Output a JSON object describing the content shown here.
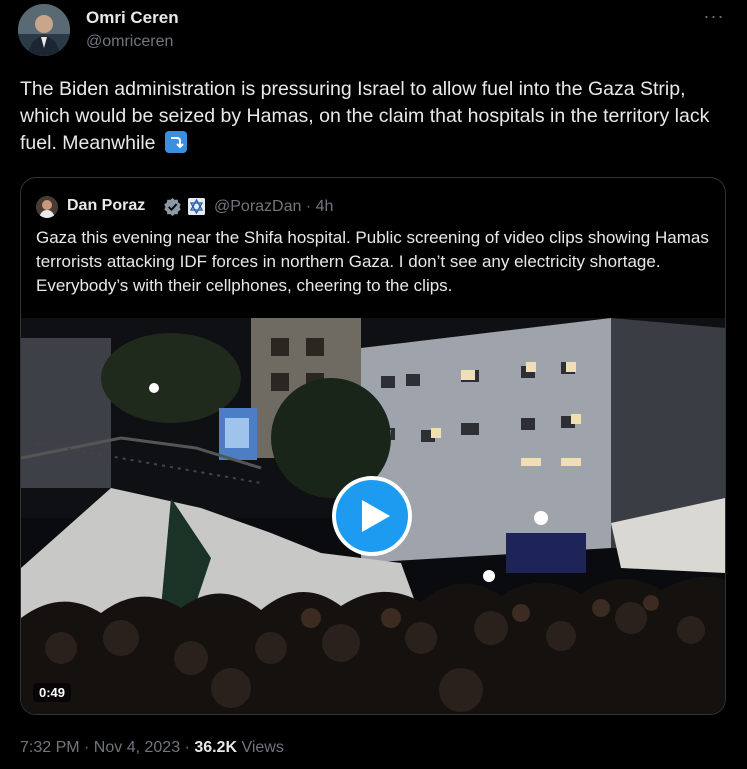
{
  "tweet": {
    "author_name": "Omri Ceren",
    "author_handle": "@omriceren",
    "more_label": "···",
    "text": "The Biden administration is pressuring Israel to allow fuel into the Gaza Strip, which would be seized by Hamas, on the claim that hospitals in the territory lack fuel. Meanwhile",
    "emoji_icon": "right-arrow-curving-down-icon"
  },
  "quote": {
    "author_name": "Dan Poraz",
    "handle_time": "@PorazDan · 4h",
    "text": "Gaza this evening near the Shifa hospital. Public screening of video clips showing Hamas terrorists attacking IDF forces in northern Gaza. I don’t see any electricity shortage. Everybody’s with their cellphones, cheering to the clips.",
    "video_duration": "0:49"
  },
  "meta": {
    "timestamp": "7:32 PM · Nov 4, 2023 · ",
    "views_count": "36.2K",
    "views_label": " Views"
  },
  "colors": {
    "background": "#000000",
    "text": "#e7e9ea",
    "secondary_text": "#71767b",
    "accent": "#1d9bf0",
    "border": "#2f3336"
  }
}
